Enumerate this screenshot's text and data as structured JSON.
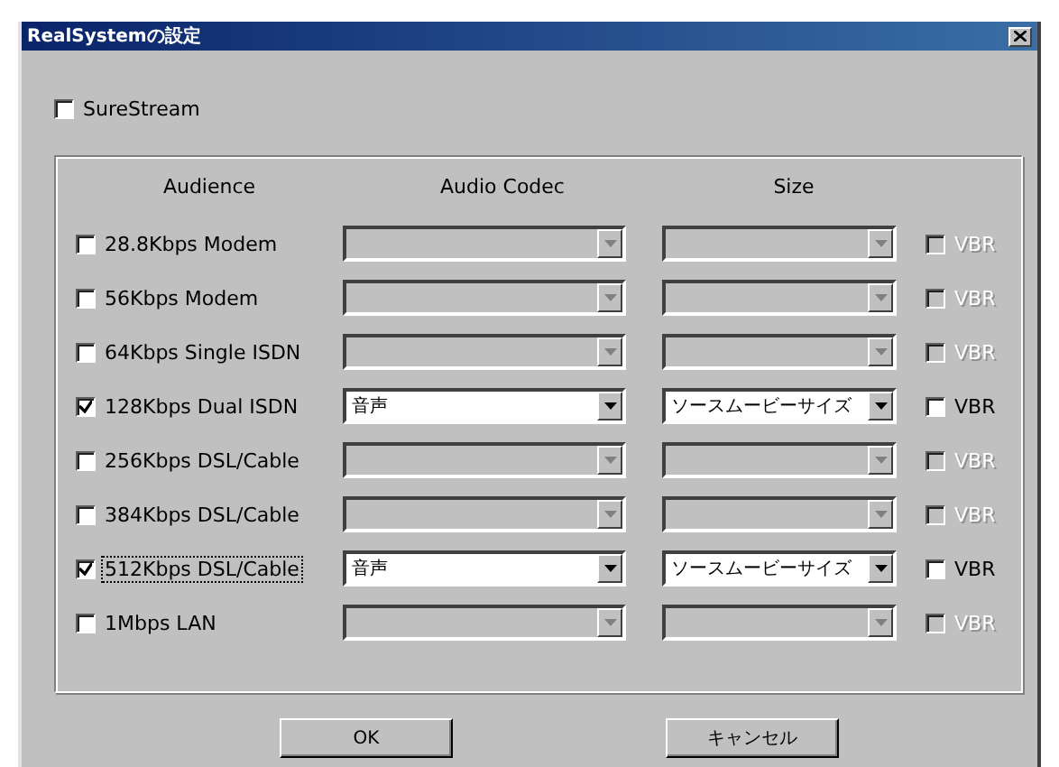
{
  "window": {
    "title": "RealSystemの設定"
  },
  "surestream": {
    "label": "SureStream",
    "checked": false
  },
  "columns": [
    "Audience",
    "Audio Codec",
    "Size"
  ],
  "rows": [
    {
      "label": "28.8Kbps Modem",
      "checked": false,
      "focused": false,
      "vbr": {
        "label": "VBR",
        "checked": false
      }
    },
    {
      "label": "56Kbps Modem",
      "checked": false,
      "focused": false,
      "vbr": {
        "label": "VBR",
        "checked": false
      }
    },
    {
      "label": "64Kbps Single ISDN",
      "checked": false,
      "focused": false,
      "vbr": {
        "label": "VBR",
        "checked": false
      }
    },
    {
      "label": "128Kbps Dual ISDN",
      "checked": true,
      "focused": false,
      "codec": "音声",
      "size": "ソースムービーサイズ",
      "vbr": {
        "label": "VBR",
        "checked": false
      }
    },
    {
      "label": "256Kbps DSL/Cable",
      "checked": false,
      "focused": false,
      "vbr": {
        "label": "VBR",
        "checked": false
      }
    },
    {
      "label": "384Kbps DSL/Cable",
      "checked": false,
      "focused": false,
      "vbr": {
        "label": "VBR",
        "checked": false
      }
    },
    {
      "label": "512Kbps DSL/Cable",
      "checked": true,
      "focused": true,
      "codec": "音声",
      "size": "ソースムービーサイズ",
      "vbr": {
        "label": "VBR",
        "checked": false
      }
    },
    {
      "label": "1Mbps LAN",
      "checked": false,
      "focused": false,
      "vbr": {
        "label": "VBR",
        "checked": false
      }
    }
  ],
  "buttons": [
    "OK",
    "キャンセル"
  ]
}
